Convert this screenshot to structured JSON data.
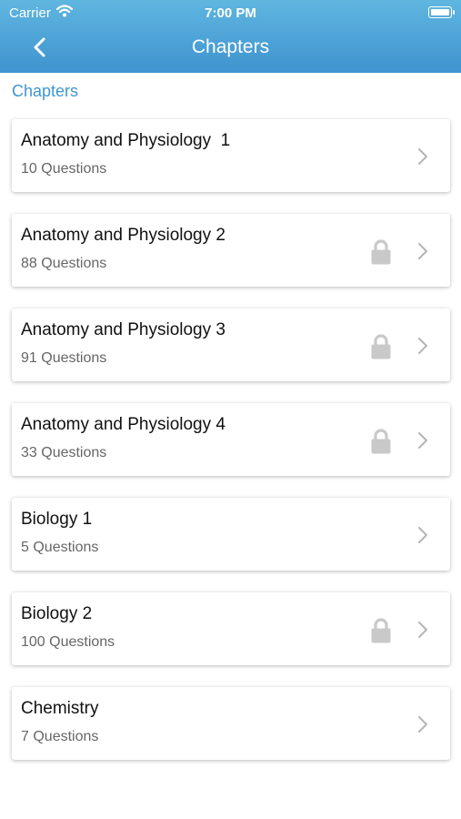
{
  "status_bar": {
    "carrier": "Carrier",
    "time": "7:00 PM"
  },
  "nav": {
    "title": "Chapters",
    "back_icon": "chevron-left-icon"
  },
  "section_label": "Chapters",
  "chapters": [
    {
      "title": "Anatomy and Physiology  1",
      "subtitle": "10 Questions",
      "locked": false
    },
    {
      "title": "Anatomy and Physiology 2",
      "subtitle": "88 Questions",
      "locked": true
    },
    {
      "title": "Anatomy and Physiology 3",
      "subtitle": "91 Questions",
      "locked": true
    },
    {
      "title": "Anatomy and Physiology 4",
      "subtitle": "33 Questions",
      "locked": true
    },
    {
      "title": "Biology 1",
      "subtitle": "5 Questions",
      "locked": false
    },
    {
      "title": "Biology 2",
      "subtitle": "100 Questions",
      "locked": true
    },
    {
      "title": "Chemistry",
      "subtitle": "7 Questions",
      "locked": false
    }
  ],
  "colors": {
    "header_top": "#5fb6df",
    "header_bottom": "#3f93cf",
    "accent": "#3f95d0",
    "lock": "#c9c9c9",
    "chevron": "#b5b5b5"
  }
}
